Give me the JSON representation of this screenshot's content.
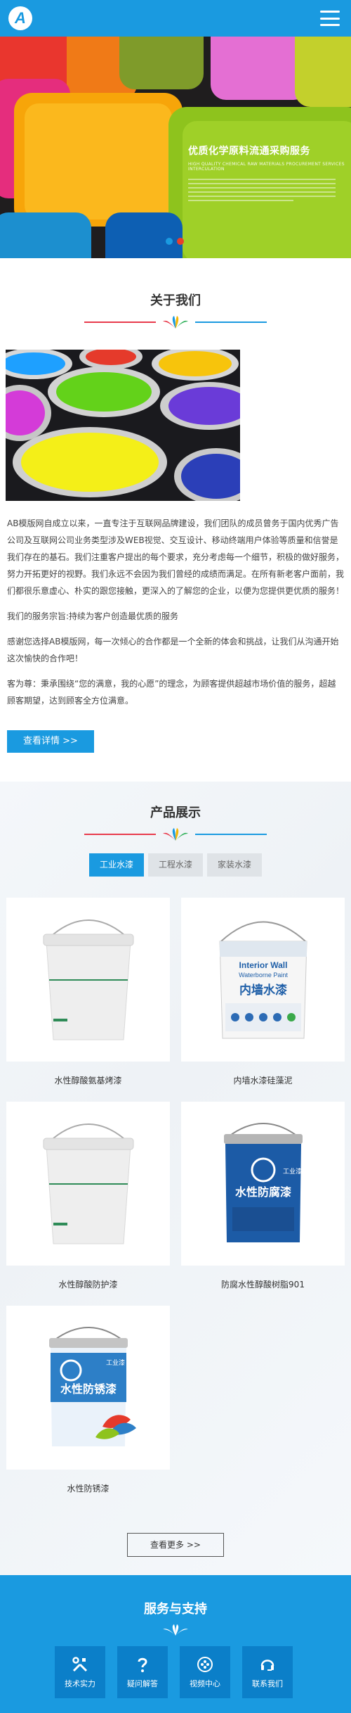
{
  "header": {
    "logo_letter": "A"
  },
  "banner": {
    "title": "优质化学原料流通采购服务",
    "subtitle_en": "HIGH QUALITY CHEMICAL RAW MATERIALS PROCUREMENT SERVICES INTERCULATION",
    "slides": 2
  },
  "about": {
    "title": "关于我们",
    "paragraphs": [
      "AB模版网自成立以来，一直专注于互联网品牌建设，我们团队的成员曾务于国内优秀广告公司及互联网公司业务类型涉及WEB视觉、交互设计、移动终端用户体验等质量和信誉是我们存在的基石。我们注重客户提出的每个要求，充分考虑每一个细节，积极的做好服务，努力开拓更好的视野。我们永远不会因为我们曾经的成绩而满足。在所有新老客户面前，我们都很乐意虚心、朴实的跟您接触，更深入的了解您的企业，以便为您提供更优质的服务！",
      "我们的服务宗旨:持续为客户创造最优质的服务",
      "感谢您选择AB模版网，每一次倾心的合作都是一个全新的体会和挑战，让我们从沟通开始这次愉快的合作吧！",
      "客为尊：秉承围绕“您的满意，我的心愿”的理念，为顾客提供超越市场价值的服务，超越顾客期望，达到顾客全方位满意。"
    ],
    "detail_button": "查看详情 >>"
  },
  "products": {
    "title": "产品展示",
    "tabs": [
      "工业水漆",
      "工程水漆",
      "家装水漆"
    ],
    "active_tab": 0,
    "items": [
      {
        "name": "水性醇酸氨基烤漆",
        "type": "white-bucket"
      },
      {
        "name": "内墙水漆硅藻泥",
        "type": "interior-wall"
      },
      {
        "name": "水性醇酸防护漆",
        "type": "white-bucket"
      },
      {
        "name": "防腐水性醇酸树脂901",
        "type": "blue-anticorrosion"
      },
      {
        "name": "水性防锈漆",
        "type": "blue-antirust"
      }
    ],
    "interior_label_en1": "Interior Wall",
    "interior_label_en2": "Waterborne Paint",
    "interior_label_cn": "内墙水漆",
    "anticorrosion_label": "水性防腐漆",
    "antirust_label": "水性防锈漆",
    "industrial_label": "工业漆",
    "more_button": "查看更多 >>"
  },
  "service": {
    "title": "服务与支持",
    "items": [
      {
        "label": "技术实力",
        "icon": "tools-icon"
      },
      {
        "label": "疑问解答",
        "icon": "question-icon"
      },
      {
        "label": "视频中心",
        "icon": "video-icon"
      },
      {
        "label": "联系我们",
        "icon": "headset-icon"
      }
    ]
  },
  "colors": {
    "primary": "#1a9ae0",
    "accent_red": "#e83b4c",
    "dark_blue": "#0b7fc9"
  }
}
